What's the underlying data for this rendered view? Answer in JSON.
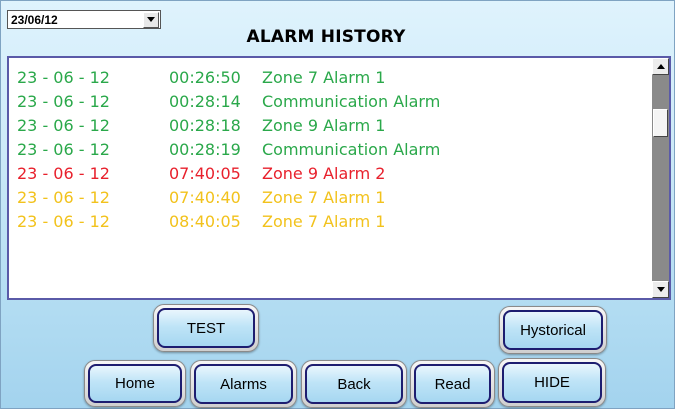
{
  "date_selector": {
    "value": "23/06/12"
  },
  "title": "ALARM HISTORY",
  "colors": {
    "normal": "#2aa84a",
    "critical": "#e8202c",
    "warning": "#f2c21c"
  },
  "alarms": [
    {
      "date": "23 - 06 - 12",
      "time": "00:26:50",
      "message": "Zone 7 Alarm 1",
      "status": "normal"
    },
    {
      "date": "23 - 06 - 12",
      "time": "00:28:14",
      "message": "Communication Alarm",
      "status": "normal"
    },
    {
      "date": "23 - 06 - 12",
      "time": "00:28:18",
      "message": "Zone 9 Alarm 1",
      "status": "normal"
    },
    {
      "date": "23 - 06 - 12",
      "time": "00:28:19",
      "message": "Communication Alarm",
      "status": "normal"
    },
    {
      "date": "23 - 06 - 12",
      "time": "07:40:05",
      "message": "Zone 9 Alarm 2",
      "status": "critical"
    },
    {
      "date": "23 - 06 - 12",
      "time": "07:40:40",
      "message": "Zone 7 Alarm 1",
      "status": "warning"
    },
    {
      "date": "23 - 06 - 12",
      "time": "08:40:05",
      "message": "Zone 7 Alarm 1",
      "status": "warning"
    }
  ],
  "buttons": {
    "test": "TEST",
    "hystorical": "Hystorical",
    "home": "Home",
    "alarms": "Alarms",
    "back": "Back",
    "read": "Read",
    "hide": "HIDE"
  }
}
